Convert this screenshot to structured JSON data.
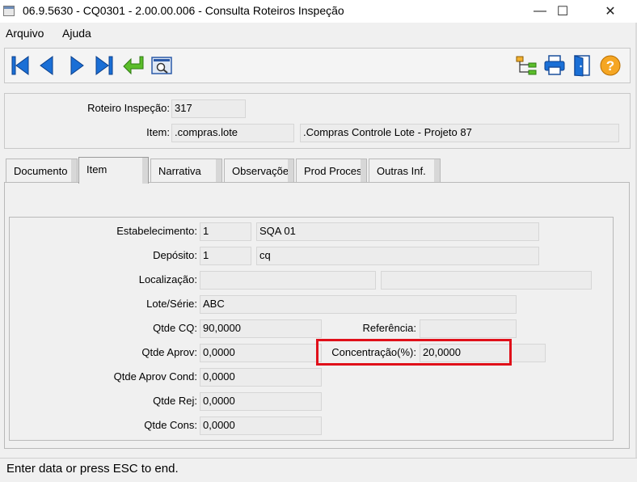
{
  "window": {
    "title": "06.9.5630 - CQ0301 - 2.00.00.006 - Consulta Roteiros Inspeção",
    "minimize_glyph": "—",
    "maximize_glyph": "☐",
    "close_glyph": "✕"
  },
  "menu": {
    "file": "Arquivo",
    "help": "Ajuda"
  },
  "toolbar": {
    "icons": [
      "first-record-icon",
      "previous-record-icon",
      "next-record-icon",
      "last-record-icon",
      "go-to-icon",
      "search-icon",
      "structure-icon",
      "print-icon",
      "exit-icon",
      "help-icon"
    ],
    "accent": "#1a6fd6"
  },
  "header": {
    "roteiro_label": "Roteiro Inspeção:",
    "roteiro_value": "317",
    "item_label": "Item:",
    "item_code": ".compras.lote",
    "item_desc": ".Compras Controle Lote - Projeto 87"
  },
  "tabs": [
    "Documento",
    "Item",
    "Narrativa",
    "Observaçõe",
    "Prod Proces",
    "Outras Inf."
  ],
  "active_tab": "Item",
  "form": {
    "estabelecimento_label": "Estabelecimento:",
    "estabelecimento_code": "1",
    "estabelecimento_name": "SQA 01",
    "deposito_label": "Depósito:",
    "deposito_code": "1",
    "deposito_name": "cq",
    "localizacao_label": "Localização:",
    "localizacao_value1": "",
    "localizacao_value2": "",
    "lote_label": "Lote/Série:",
    "lote_value": "ABC",
    "qtde_cq_label": "Qtde CQ:",
    "qtde_cq_value": "90,0000",
    "referencia_label": "Referência:",
    "referencia_value": "",
    "qtde_aprov_label": "Qtde Aprov:",
    "qtde_aprov_value": "0,0000",
    "concentracao_label": "Concentração(%):",
    "concentracao_value": "20,0000",
    "qtde_aprov_cond_label": "Qtde Aprov Cond:",
    "qtde_aprov_cond_value": "0,0000",
    "qtde_rej_label": "Qtde Rej:",
    "qtde_rej_value": "0,0000",
    "qtde_cons_label": "Qtde Cons:",
    "qtde_cons_value": "0,0000"
  },
  "annotation": {
    "highlight_color": "#e0101a"
  },
  "status": {
    "message": "Enter data or press ESC to end."
  }
}
